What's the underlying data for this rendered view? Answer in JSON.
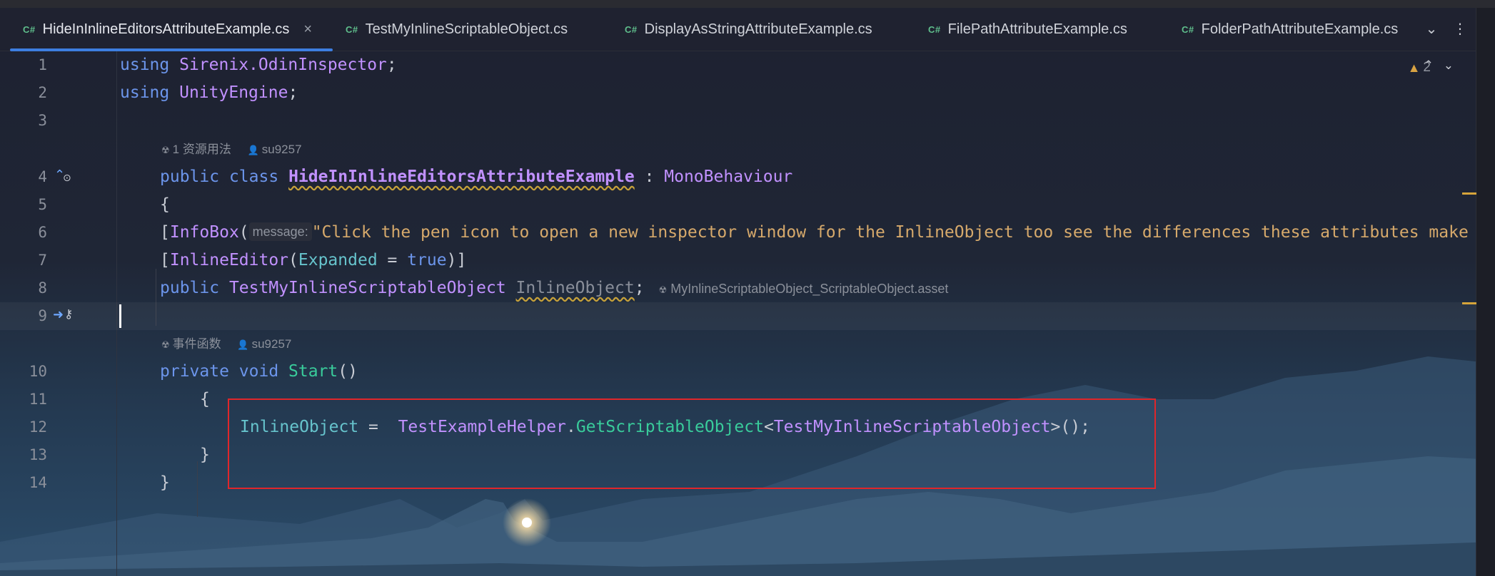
{
  "tabs": [
    {
      "lang": "C#",
      "label": "HideInInlineEditorsAttributeExample.cs",
      "active": true
    },
    {
      "lang": "C#",
      "label": "TestMyInlineScriptableObject.cs",
      "active": false
    },
    {
      "lang": "C#",
      "label": "DisplayAsStringAttributeExample.cs",
      "active": false
    },
    {
      "lang": "C#",
      "label": "FilePathAttributeExample.cs",
      "active": false
    },
    {
      "lang": "C#",
      "label": "FolderPathAttributeExample.cs",
      "active": false
    }
  ],
  "tab_close": "×",
  "tab_actions": {
    "more_tabs": "⌄",
    "menu": "⋮"
  },
  "inspections": {
    "warning_count": "2",
    "up": "⌃",
    "down": "⌄"
  },
  "line_numbers": [
    "1",
    "2",
    "3",
    "4",
    "5",
    "6",
    "7",
    "8",
    "9",
    "10",
    "11",
    "12",
    "13",
    "14"
  ],
  "code": {
    "l1": {
      "kw": "using",
      "ns": "Sirenix.OdinInspector",
      "end": ";"
    },
    "l2": {
      "kw": "using",
      "ns": "UnityEngine",
      "end": ";"
    },
    "lens1": {
      "usages": "1 资源用法",
      "author": "su9257"
    },
    "l4": {
      "kw1": "public",
      "kw2": "class",
      "cls": "HideInInlineEditorsAttributeExample",
      "colon": " : ",
      "base": "MonoBehaviour"
    },
    "l5": "{",
    "l6": {
      "open": "[",
      "attr": "InfoBox",
      "paren": "(",
      "hint": "message:",
      "str": "\"Click the pen icon to open a new inspector window for the InlineObject too see the differences these attributes make"
    },
    "l7": {
      "open": "[",
      "attr": "InlineEditor",
      "paren": "(",
      "arg": "Expanded",
      "eq": " = ",
      "val": "true",
      "close": ")]"
    },
    "l8": {
      "kw": "public",
      "type": "TestMyInlineScriptableObject",
      "field": "InlineObject",
      "end": ";",
      "asset": "MyInlineScriptableObject_ScriptableObject.asset"
    },
    "lens2": {
      "label": "事件函数",
      "author": "su9257"
    },
    "l10": {
      "kw1": "private",
      "kw2": "void",
      "method": "Start",
      "parens": "()"
    },
    "l11": "{",
    "l12": {
      "field": "InlineObject",
      "eq": " =  ",
      "helper": "TestExampleHelper",
      "dot": ".",
      "method": "GetScriptableObject",
      "lt": "<",
      "type": "TestMyInlineScriptableObject",
      "gt": ">",
      "end": "();"
    },
    "l13": "}",
    "l14": "}"
  },
  "colors": {
    "accent": "#3d7ee0",
    "highlight_box": "#e0262a",
    "keyword": "#6c95eb",
    "type": "#c191ff",
    "method": "#39cc9b",
    "string": "#d6a96b"
  }
}
